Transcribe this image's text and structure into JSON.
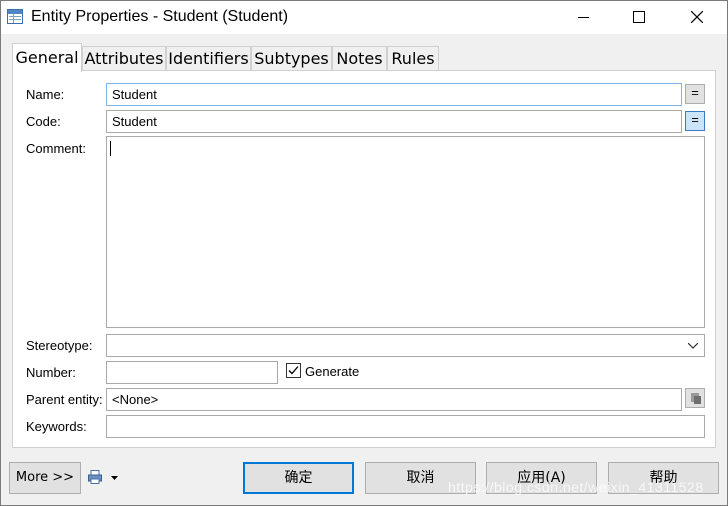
{
  "window": {
    "title": "Entity Properties - Student (Student)",
    "icon": "entity-table-icon"
  },
  "titlebar_buttons": [
    "minimize-icon",
    "maximize-icon",
    "close-icon"
  ],
  "tabs": [
    {
      "label": "General",
      "active": true
    },
    {
      "label": "Attributes",
      "active": false
    },
    {
      "label": "Identifiers",
      "active": false
    },
    {
      "label": "Subtypes",
      "active": false
    },
    {
      "label": "Notes",
      "active": false
    },
    {
      "label": "Rules",
      "active": false
    }
  ],
  "form": {
    "name_label": "Name:",
    "name_value": "Student",
    "code_label": "Code:",
    "code_value": "Student",
    "equals_label": "=",
    "comment_label": "Comment:",
    "comment_value": "",
    "stereotype_label": "Stereotype:",
    "stereotype_value": "",
    "number_label": "Number:",
    "number_value": "",
    "generate_label": "Generate",
    "generate_checked": true,
    "parent_label": "Parent entity:",
    "parent_value": "<None>",
    "keywords_label": "Keywords:",
    "keywords_value": ""
  },
  "buttons": {
    "more": "More >>",
    "ok": "确定",
    "cancel": "取消",
    "apply": "应用(A)",
    "help": "帮助"
  },
  "watermark": "https://blog.csdn.net/weixin_41311528",
  "colors": {
    "accent": "#0078d7",
    "focus_border": "#7eb4ea"
  }
}
